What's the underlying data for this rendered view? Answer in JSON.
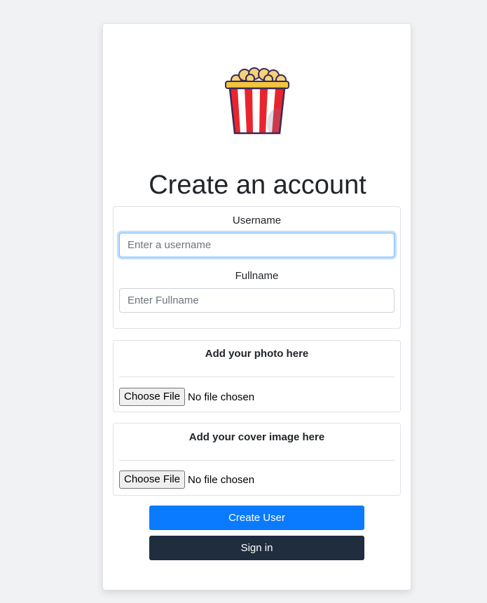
{
  "form": {
    "title": "Create an account",
    "logo_icon": "popcorn-bucket-icon",
    "username": {
      "label": "Username",
      "placeholder": "Enter a username",
      "value": ""
    },
    "fullname": {
      "label": "Fullname",
      "placeholder": "Enter Fullname",
      "value": ""
    },
    "photo": {
      "title": "Add your photo here",
      "button_label": "Choose File",
      "status": "No file chosen"
    },
    "cover": {
      "title": "Add your cover image here",
      "button_label": "Choose File",
      "status": "No file chosen"
    },
    "create_button": "Create User",
    "signin_button": "Sign in"
  },
  "colors": {
    "page_background": "#f1f2f4",
    "primary": "#0a7bff",
    "dark": "#1f2d3f"
  }
}
